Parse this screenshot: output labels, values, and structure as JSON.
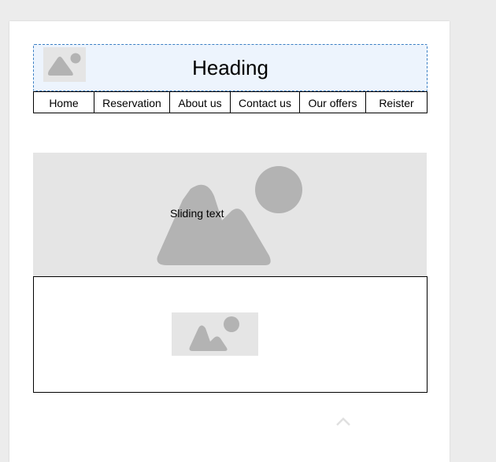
{
  "header": {
    "title": "Heading",
    "logo_icon": "image-placeholder-icon"
  },
  "nav": {
    "items": [
      {
        "label": "Home"
      },
      {
        "label": "Reservation"
      },
      {
        "label": "About us"
      },
      {
        "label": "Contact us"
      },
      {
        "label": "Our offers"
      },
      {
        "label": "Reister"
      }
    ]
  },
  "slider": {
    "text": "Sliding text",
    "image_icon": "image-placeholder-icon"
  },
  "content": {
    "image_icon": "image-placeholder-icon"
  },
  "scroll_top": {
    "icon": "chevron-up-icon"
  },
  "colors": {
    "background": "#ececec",
    "header_fill": "#edf4fd",
    "header_border": "#3b7fc4",
    "placeholder_fill": "#e5e5e5",
    "placeholder_shape": "#b3b3b3"
  }
}
